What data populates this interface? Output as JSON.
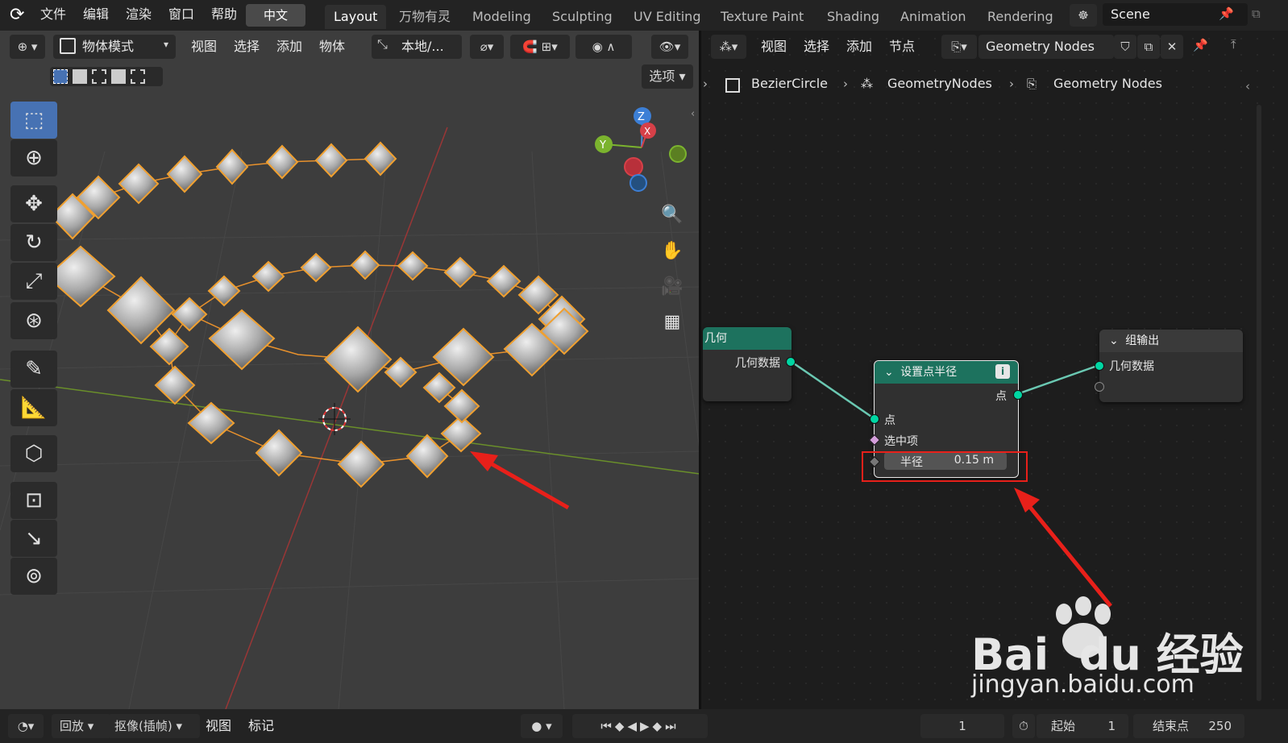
{
  "topbar": {
    "menus": [
      "文件",
      "编辑",
      "渲染",
      "窗口",
      "帮助"
    ],
    "lang": "中文",
    "workspaces": [
      "Layout",
      "万物有灵",
      "Modeling",
      "Sculpting",
      "UV Editing",
      "Texture Paint",
      "Shading",
      "Animation",
      "Rendering"
    ],
    "scene": "Scene"
  },
  "viewport": {
    "mode": "物体模式",
    "menus": [
      "视图",
      "选择",
      "添加",
      "物体"
    ],
    "transform": "本地/...",
    "options": "选项"
  },
  "gizmo": {
    "z": "Z",
    "y": "Y",
    "x": "X"
  },
  "node_editor": {
    "menus": [
      "视图",
      "选择",
      "添加",
      "节点"
    ],
    "tree_name": "Geometry Nodes",
    "breadcrumb": [
      "BezierCircle",
      "GeometryNodes",
      "Geometry Nodes"
    ],
    "group_input": {
      "title": "几何",
      "output": "几何数据"
    },
    "set_radius": {
      "title": "设置点半径",
      "out": "点",
      "in_points": "点",
      "in_selection": "选中项",
      "radius_label": "半径",
      "radius_value": "0.15 m"
    },
    "group_output": {
      "title": "组输出",
      "input": "几何数据"
    }
  },
  "timeline": {
    "playback": "回放",
    "keying": "抠像(插帧)",
    "view": "视图",
    "marker": "标记",
    "frame": "1",
    "start_label": "起始",
    "start": "1",
    "end_label": "结束点",
    "end": "250"
  },
  "watermark": {
    "brand": "Bai  du 经验",
    "url": "jingyan.baidu.com"
  }
}
